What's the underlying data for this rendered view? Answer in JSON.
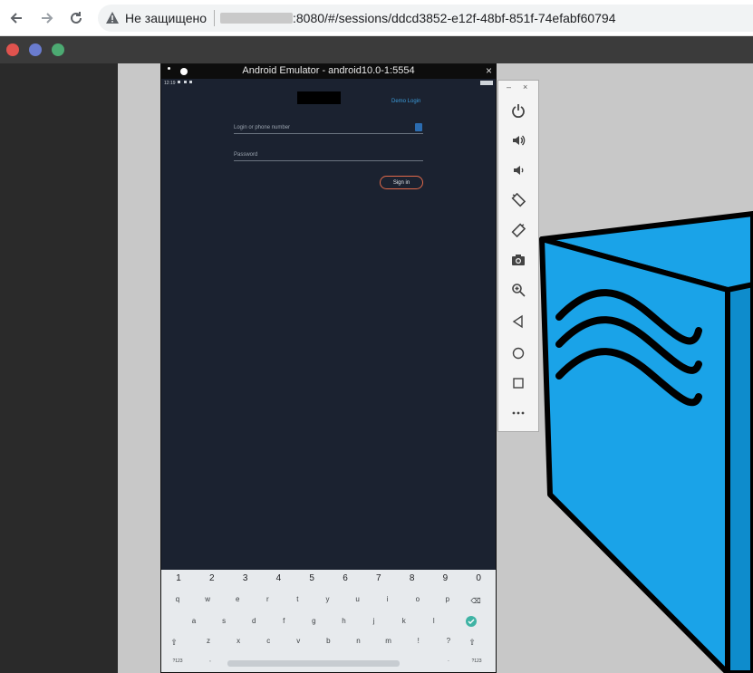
{
  "browser": {
    "insecure_label": "Не защищено",
    "url": ":8080/#/sessions/ddcd3852-e12f-48bf-851f-74efabf60794"
  },
  "desktop": {
    "dots": [
      "#e0534e",
      "#6a7ccf",
      "#4caa72"
    ]
  },
  "emulator": {
    "title": "Android Emulator - android10.0-1:5554",
    "status_time": "12:19",
    "app": {
      "demo_login": "Demo Login",
      "login_placeholder": "Login or phone number",
      "password_placeholder": "Password",
      "sign_in": "Sign in"
    },
    "keyboard": {
      "numbers": [
        "1",
        "2",
        "3",
        "4",
        "5",
        "6",
        "7",
        "8",
        "9",
        "0"
      ],
      "row1": [
        "q",
        "w",
        "e",
        "r",
        "t",
        "y",
        "u",
        "i",
        "o",
        "p"
      ],
      "row2": [
        "a",
        "s",
        "d",
        "f",
        "g",
        "h",
        "j",
        "k",
        "l"
      ],
      "row3": [
        "z",
        "x",
        "c",
        "v",
        "b",
        "n",
        "m",
        "!",
        "?"
      ],
      "symbols_key": "?123",
      "comma": ",",
      "period": "."
    }
  },
  "side_panel": {
    "minimize": "–",
    "close": "×",
    "buttons": [
      "power-icon",
      "volume-up-icon",
      "volume-down-icon",
      "rotate-left-icon",
      "rotate-right-icon",
      "camera-icon",
      "zoom-icon",
      "back-icon",
      "home-icon",
      "overview-icon",
      "more-icon"
    ]
  },
  "colors": {
    "emulator_bg": "#1b2230",
    "accent": "#3b9bd9",
    "signin_border": "#e26a4a",
    "cube": "#1aa3e8"
  }
}
